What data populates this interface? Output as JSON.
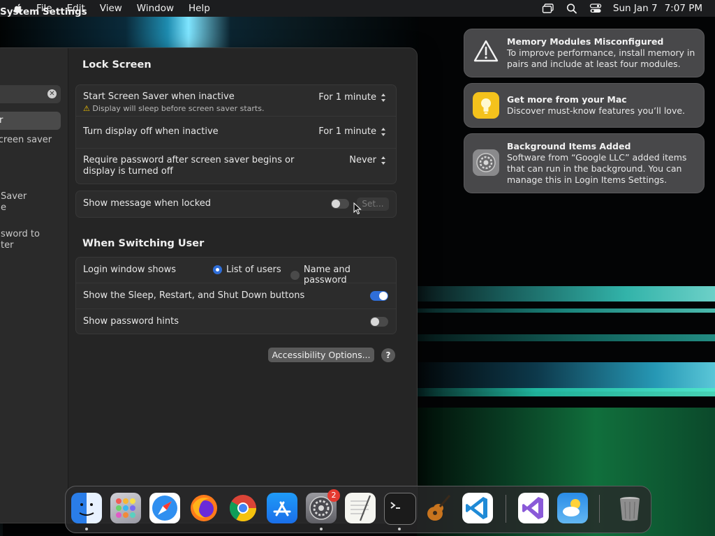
{
  "menubar": {
    "app_name": "System Settings",
    "items": [
      "File",
      "Edit",
      "View",
      "Window",
      "Help"
    ],
    "date": "Sun Jan 7",
    "time": "7:07 PM"
  },
  "sidebar": {
    "fragments": [
      "r",
      "screen saver",
      "Saver",
      "e",
      "sword to",
      "ter"
    ]
  },
  "lock_screen": {
    "title": "Lock Screen",
    "rows": [
      {
        "label": "Start Screen Saver when inactive",
        "value": "For 1 minute",
        "warning": "Display will sleep before screen saver starts."
      },
      {
        "label": "Turn display off when inactive",
        "value": "For 1 minute"
      },
      {
        "label": "Require password after screen saver begins or display is turned off",
        "value": "Never"
      }
    ],
    "message_row": {
      "label": "Show message when locked",
      "set_label": "Set...",
      "enabled": false
    }
  },
  "switching": {
    "title": "When Switching User",
    "login_label": "Login window shows",
    "options": [
      "List of users",
      "Name and password"
    ],
    "selected_option": "List of users",
    "sleep_label": "Show the Sleep, Restart, and Shut Down buttons",
    "sleep_on": true,
    "hints_label": "Show password hints",
    "hints_on": false
  },
  "actions": {
    "accessibility_label": "Accessibility Options...",
    "help_label": "?"
  },
  "notifications": [
    {
      "title": "Memory Modules Misconfigured",
      "body": "To improve performance, install memory in pairs and include at least four modules.",
      "icon": "warning-icon"
    },
    {
      "title": "Get more from your Mac",
      "body": "Discover must-know features you’ll love.",
      "icon": "tips-lightbulb-icon"
    },
    {
      "title": "Background Items Added",
      "body": "Software from “Google LLC” added items that can run in the background. You can manage this in Login Items Settings.",
      "icon": "system-settings-gear-icon"
    }
  ],
  "dock": {
    "apps": [
      "finder",
      "launchpad",
      "safari",
      "firefox",
      "chrome",
      "app-store",
      "system-settings",
      "textedit",
      "terminal",
      "garageband",
      "vscode",
      "visual-studio",
      "weather",
      "trash"
    ],
    "system_settings_badge": "2"
  },
  "colors": {
    "accent": "#2f6ed8",
    "badge": "#e53a30",
    "warning": "#f5c400"
  }
}
